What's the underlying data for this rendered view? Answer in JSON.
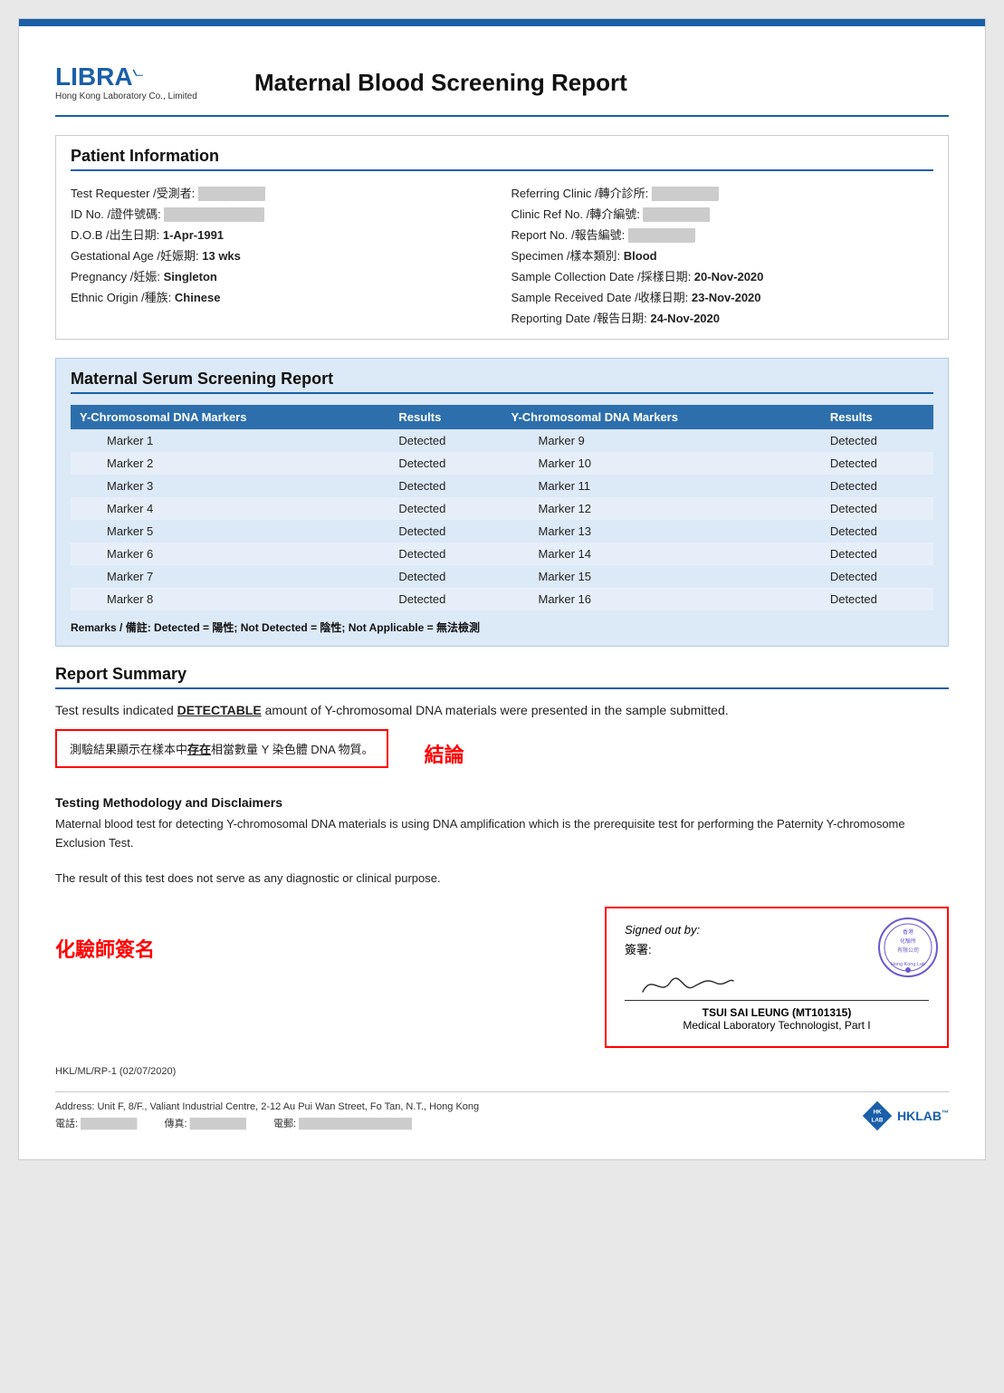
{
  "header": {
    "logo_text": "LIBRA",
    "logo_subtitle": "Hong Kong Laboratory Co., Limited",
    "report_title": "Maternal Blood Screening Report"
  },
  "patient_info": {
    "section_title": "Patient Information",
    "left_fields": [
      {
        "label": "Test Requester /受測者:",
        "value": "████████"
      },
      {
        "label": "ID No. /證件號碼:",
        "value": "████████████"
      },
      {
        "label": "D.O.B /出生日期:",
        "value": "1-Apr-1991"
      },
      {
        "label": "Gestational Age /妊娠期:",
        "value": "13 wks"
      },
      {
        "label": "Pregnancy /妊娠:",
        "value": "Singleton"
      },
      {
        "label": "Ethnic Origin /種族:",
        "value": "Chinese"
      }
    ],
    "right_fields": [
      {
        "label": "Referring Clinic /轉介診所:",
        "value": "████████"
      },
      {
        "label": "Clinic Ref No. /轉介編號:",
        "value": "████████"
      },
      {
        "label": "Report No. /報告編號:",
        "value": "████████"
      },
      {
        "label": "Specimen /樣本類別:",
        "value": "Blood"
      },
      {
        "label": "Sample Collection Date /採樣日期:",
        "value": "20-Nov-2020"
      },
      {
        "label": "Sample Received Date /收樣日期:",
        "value": "23-Nov-2020"
      },
      {
        "label": "Reporting Date /報告日期:",
        "value": "24-Nov-2020"
      }
    ]
  },
  "serum_section": {
    "title": "Maternal Serum Screening Report",
    "col1_header": "Y-Chromosomal DNA Markers",
    "col2_header": "Results",
    "col3_header": "Y-Chromosomal DNA Markers",
    "col4_header": "Results",
    "left_markers": [
      {
        "marker": "Marker 1",
        "result": "Detected"
      },
      {
        "marker": "Marker 2",
        "result": "Detected"
      },
      {
        "marker": "Marker 3",
        "result": "Detected"
      },
      {
        "marker": "Marker 4",
        "result": "Detected"
      },
      {
        "marker": "Marker 5",
        "result": "Detected"
      },
      {
        "marker": "Marker 6",
        "result": "Detected"
      },
      {
        "marker": "Marker 7",
        "result": "Detected"
      },
      {
        "marker": "Marker 8",
        "result": "Detected"
      }
    ],
    "right_markers": [
      {
        "marker": "Marker 9",
        "result": "Detected"
      },
      {
        "marker": "Marker 10",
        "result": "Detected"
      },
      {
        "marker": "Marker 11",
        "result": "Detected"
      },
      {
        "marker": "Marker 12",
        "result": "Detected"
      },
      {
        "marker": "Marker 13",
        "result": "Detected"
      },
      {
        "marker": "Marker 14",
        "result": "Detected"
      },
      {
        "marker": "Marker 15",
        "result": "Detected"
      },
      {
        "marker": "Marker 16",
        "result": "Detected"
      }
    ],
    "remarks": "Remarks / 備註: Detected = 陽性; Not Detected = 陰性; Not Applicable = 無法檢測"
  },
  "report_summary": {
    "title": "Report Summary",
    "text_line1": "Test results indicated ",
    "text_highlight": "DETECTABLE",
    "text_line2": " amount of Y-chromosomal DNA materials were presented in the sample",
    "text_line3": "submitted.",
    "conclusion_chinese": "測驗結果顯示在樣本中",
    "conclusion_chinese_underline": "存在",
    "conclusion_chinese_end": "相當數量 Y 染色體 DNA 物質。",
    "jie_lun": "結論"
  },
  "methodology": {
    "title": "Testing Methodology and Disclaimers",
    "text1": "Maternal blood test for detecting Y-chromosomal DNA materials is using DNA amplification which is the prerequisite test",
    "text2": "for performing the Paternity Y-chromosome Exclusion Test.",
    "text3": "The result of this test does not serve as any diagnostic or clinical purpose."
  },
  "signature": {
    "chemist_label": "化驗師簽名",
    "signed_out_by": "Signed out by:",
    "sign_chinese": "簽署:",
    "signer_name": "TSUI SAI LEUNG (MT101315)",
    "signer_title": "Medical Laboratory Technologist, Part I"
  },
  "footer": {
    "ref": "HKL/ML/RP-1 (02/07/2020)",
    "address": "Address: Unit F, 8/F., Valiant Industrial Centre, 2-12 Au Pui Wan Street, Fo Tan, N.T., Hong Kong",
    "phone1": "電話: ████████████",
    "fax": "傳真: ████████████",
    "email": "電郵: ████████████",
    "hklab_text": "HKLAB"
  }
}
